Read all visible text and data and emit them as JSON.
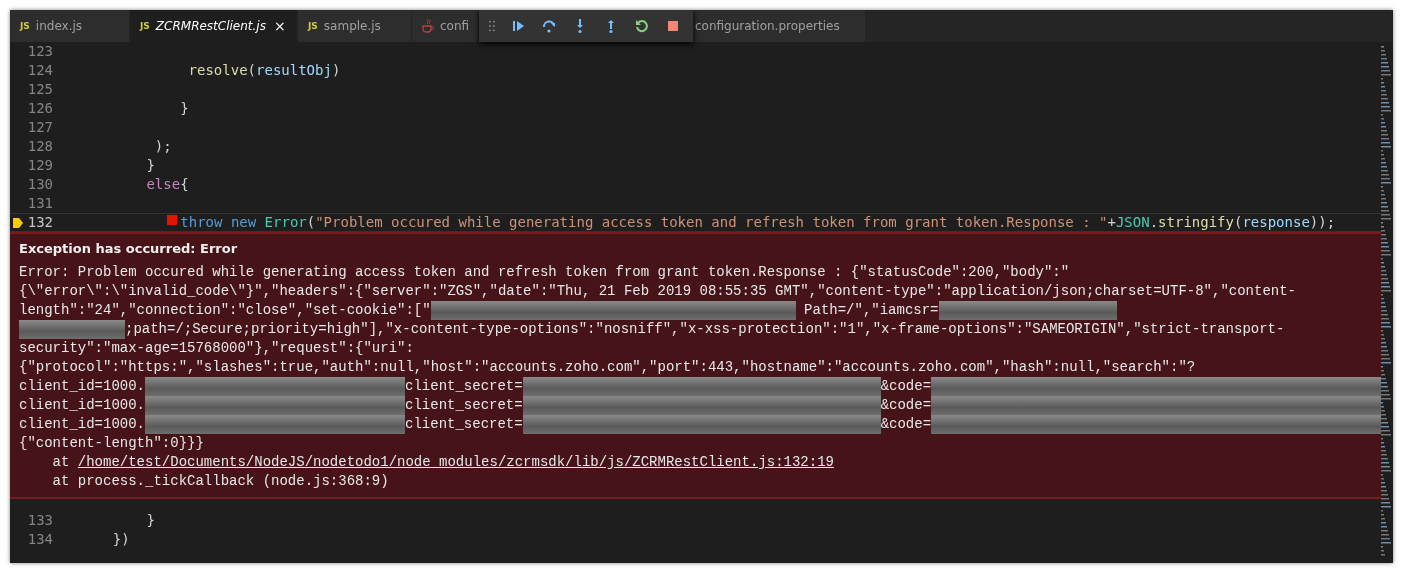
{
  "tabs": [
    {
      "label": "index.js",
      "kind": "js",
      "badge": "JS",
      "selected": false
    },
    {
      "label": "ZCRMRestClient.js",
      "kind": "js",
      "badge": "JS",
      "selected": true,
      "close": "×"
    },
    {
      "label": "sample.js",
      "kind": "js",
      "badge": "JS",
      "selected": false
    },
    {
      "label": "confi",
      "kind": "java",
      "selected": false
    },
    {
      "label": "configuration.properties",
      "kind": "plain",
      "selected": false
    }
  ],
  "debug_toolbar": {
    "buttons": [
      {
        "kind": "continue"
      },
      {
        "kind": "step-over"
      },
      {
        "kind": "step-into"
      },
      {
        "kind": "step-out"
      },
      {
        "kind": "restart"
      },
      {
        "kind": "stop"
      }
    ]
  },
  "editor": {
    "lines_before": [
      {
        "number": "123",
        "current": false,
        "breakpoint": false
      },
      {
        "number": "124",
        "current": false,
        "breakpoint": false,
        "tokens": [
          {
            "kind": "fn",
            "text": "resolve"
          },
          {
            "kind": "punct",
            "text": "("
          },
          {
            "kind": "var",
            "text": "resultObj"
          },
          {
            "kind": "punct",
            "text": ")"
          }
        ]
      },
      {
        "number": "125",
        "current": false,
        "breakpoint": false
      },
      {
        "number": "126",
        "current": false,
        "breakpoint": false,
        "tokens": [
          {
            "kind": "punct",
            "text": "}"
          }
        ]
      },
      {
        "number": "127",
        "current": false,
        "breakpoint": false
      },
      {
        "number": "128",
        "current": false,
        "breakpoint": false,
        "tokens": [
          {
            "kind": "punct",
            "text": ");"
          }
        ]
      },
      {
        "number": "129",
        "current": false,
        "breakpoint": false,
        "tokens": [
          {
            "kind": "punct",
            "text": "}"
          }
        ]
      },
      {
        "number": "130",
        "current": false,
        "breakpoint": false,
        "tokens": [
          {
            "kind": "control",
            "text": "else"
          },
          {
            "kind": "punct",
            "text": "{"
          }
        ]
      },
      {
        "number": "131",
        "current": false,
        "breakpoint": false
      },
      {
        "number": "132",
        "current": true,
        "breakpoint": true,
        "tokens": [
          {
            "kind": "keyword",
            "text": "throw "
          },
          {
            "kind": "keyword",
            "text": "new "
          },
          {
            "kind": "type",
            "text": "Error"
          },
          {
            "kind": "punct",
            "text": "("
          },
          {
            "kind": "string",
            "text": "\"Problem occured while generating access token and refresh token from grant token.Response : \""
          },
          {
            "kind": "punct",
            "text": "+"
          },
          {
            "kind": "type",
            "text": "JSON"
          },
          {
            "kind": "punct",
            "text": "."
          },
          {
            "kind": "fn",
            "text": "stringify"
          },
          {
            "kind": "punct",
            "text": "("
          },
          {
            "kind": "var",
            "text": "response"
          },
          {
            "kind": "punct",
            "text": "));"
          }
        ]
      }
    ],
    "exception": {
      "title": "Exception has occurred: Error",
      "lines": [
        [
          {
            "kind": "text",
            "text": "Error: Problem occured while generating access token and refresh token from grant token.Response : {\"statusCode\":200,\"body\":\""
          }
        ],
        [
          {
            "kind": "text",
            "text": "{\\\"error\\\":\\\"invalid_code\\\"}\",\"headers\":{\"server\":\"ZGS\",\"date\":\"Thu, 21 Feb 2019 08:55:35 GMT\",\"content-type\":\"application/json;charset=UTF-8\",\"content-"
          }
        ],
        [
          {
            "kind": "text",
            "text": "length\":\"24\",\"connection\":\"close\",\"set-cookie\":[\""
          },
          {
            "kind": "redacted"
          },
          {
            "kind": "text",
            "text": " Path=/\",\"iamcsr="
          },
          {
            "kind": "redacted"
          }
        ],
        [
          {
            "kind": "redacted"
          },
          {
            "kind": "text",
            "text": ";path=/;Secure;priority=high\"],\"x-content-type-options\":\"nosniff\",\"x-xss-protection\":\"1\",\"x-frame-options\":\"SAMEORIGIN\",\"strict-transport-"
          }
        ],
        [
          {
            "kind": "text",
            "text": "security\":\"max-age=15768000\"},\"request\":{\"uri\":"
          }
        ],
        [
          {
            "kind": "text",
            "text": "{\"protocol\":\"https:\",\"slashes\":true,\"auth\":null,\"host\":\"accounts.zoho.com\",\"port\":443,\"hostname\":\"accounts.zoho.com\",\"hash\":null,\"search\":\"?"
          }
        ],
        [
          {
            "kind": "text",
            "text": "client_id=1000."
          },
          {
            "kind": "redacted"
          },
          {
            "kind": "text",
            "text": "client_secret="
          },
          {
            "kind": "redacted"
          },
          {
            "kind": "text",
            "text": "&code="
          },
          {
            "kind": "redacted"
          }
        ],
        [
          {
            "kind": "text",
            "text": "client_id=1000."
          },
          {
            "kind": "redacted"
          },
          {
            "kind": "text",
            "text": "client_secret="
          },
          {
            "kind": "redacted"
          },
          {
            "kind": "text",
            "text": "&code="
          },
          {
            "kind": "redacted"
          }
        ],
        [
          {
            "kind": "text",
            "text": "client_id=1000."
          },
          {
            "kind": "redacted"
          },
          {
            "kind": "text",
            "text": "client_secret="
          },
          {
            "kind": "redacted"
          },
          {
            "kind": "text",
            "text": "&code="
          },
          {
            "kind": "redacted"
          }
        ],
        [
          {
            "kind": "text",
            "text": "{\"content-length\":0}}}"
          }
        ],
        [
          {
            "kind": "text",
            "text": "    at "
          },
          {
            "kind": "link",
            "text": "/home/test/Documents/NodeJS/nodetodo1/node_modules/zcrmsdk/lib/js/ZCRMRestClient.js:132:19"
          }
        ],
        [
          {
            "kind": "text",
            "text": "    at process._tickCallback (node.js:368:9)"
          }
        ]
      ]
    },
    "lines_after": [
      {
        "number": "133",
        "current": false,
        "breakpoint": false,
        "tokens": [
          {
            "kind": "punct",
            "text": "}"
          }
        ]
      },
      {
        "number": "134",
        "current": false,
        "breakpoint": false,
        "tokens": [
          {
            "kind": "punct",
            "text": "})"
          }
        ]
      }
    ]
  }
}
